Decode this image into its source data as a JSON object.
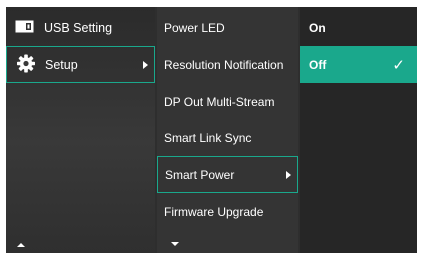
{
  "menu_level1": {
    "items": [
      {
        "label": "USB Setting",
        "icon": "usb-setting-icon"
      },
      {
        "label": "Setup",
        "icon": "gear-icon"
      }
    ]
  },
  "menu_level2": {
    "items": [
      {
        "label": "Power LED"
      },
      {
        "label": "Resolution Notification"
      },
      {
        "label": "DP Out Multi-Stream"
      },
      {
        "label": "Smart Link Sync"
      },
      {
        "label": "Smart Power"
      },
      {
        "label": "Firmware Upgrade"
      }
    ]
  },
  "menu_level3": {
    "options": [
      {
        "label": "On"
      },
      {
        "label": "Off",
        "checkmark": "✓"
      }
    ]
  },
  "colors": {
    "accent": "#1aa88c",
    "background": "#2e2e2e",
    "text": "#ffffff"
  }
}
